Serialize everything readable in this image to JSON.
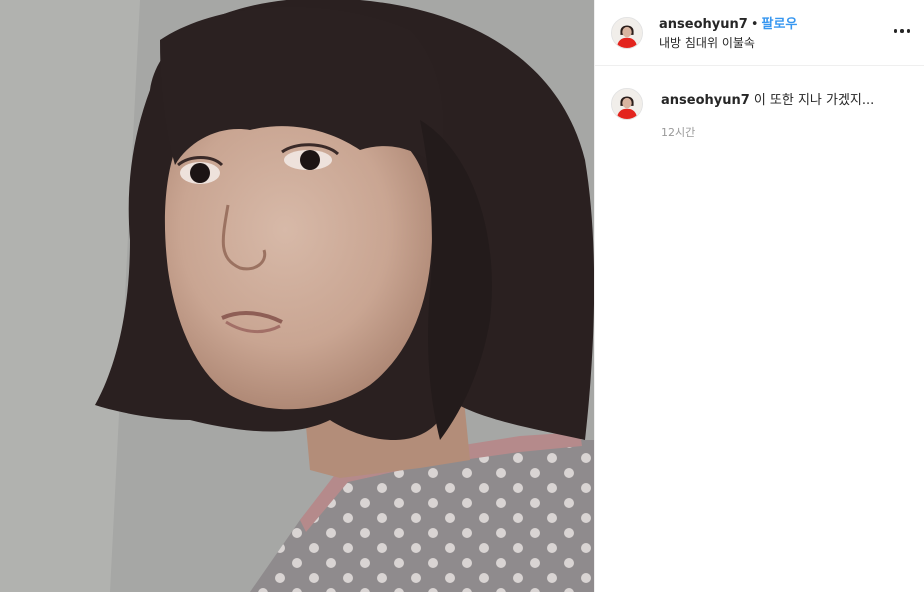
{
  "post": {
    "username": "anseohyun7",
    "separator": "•",
    "follow_label": "팔로우",
    "location": "내방 침대위 이불속"
  },
  "caption": {
    "username": "anseohyun7",
    "text": "이 또한 지나 가겠지...",
    "time": "12시간"
  },
  "icons": {
    "more": "more-options-icon"
  },
  "colors": {
    "follow_blue": "#3897f0",
    "text_primary": "#262626",
    "text_secondary": "#999999",
    "divider": "#efefef"
  }
}
